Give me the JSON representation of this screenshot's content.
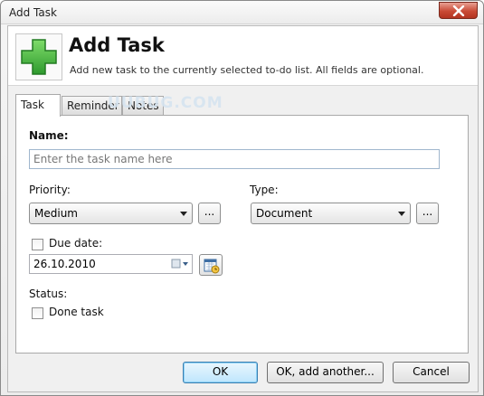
{
  "window": {
    "title": "Add Task"
  },
  "header": {
    "title": "Add Task",
    "subtitle": "Add new task to the currently selected to-do list. All fields are optional."
  },
  "tabs": [
    {
      "label": "Task",
      "active": true
    },
    {
      "label": "Reminder",
      "active": false
    },
    {
      "label": "Notes",
      "active": false
    }
  ],
  "watermark": "UUBUG.COM",
  "form": {
    "name_label": "Name:",
    "name_placeholder": "Enter the task name here",
    "priority_label": "Priority:",
    "priority_value": "Medium",
    "priority_more": "...",
    "type_label": "Type:",
    "type_value": "Document",
    "type_more": "...",
    "due_date_label": "Due date:",
    "due_date_checked": false,
    "due_date_value": "26.10.2010",
    "status_label": "Status:",
    "done_label": "Done task",
    "done_checked": false
  },
  "buttons": {
    "ok": "OK",
    "ok_add_another": "OK, add another...",
    "cancel": "Cancel"
  },
  "icons": {
    "header": "add-plus-icon",
    "close": "close-icon",
    "calendar": "calendar-icon",
    "dropdown": "chevron-down-icon"
  },
  "colors": {
    "plus_green": "#3aa63a",
    "close_red": "#c94a35",
    "default_button_border": "#3c7fb1"
  }
}
